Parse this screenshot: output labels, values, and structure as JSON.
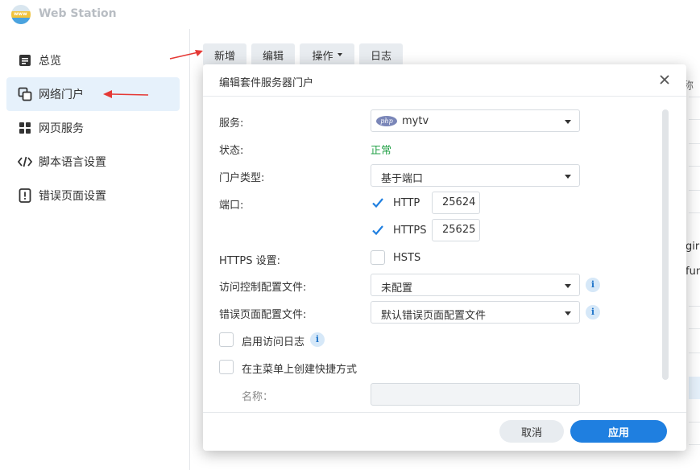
{
  "app": {
    "title": "Web Station",
    "logo_text": "www"
  },
  "sidebar": {
    "items": [
      {
        "label": "总览",
        "icon": "overview-icon"
      },
      {
        "label": "网络门户",
        "icon": "web-portal-icon"
      },
      {
        "label": "网页服务",
        "icon": "web-service-icon"
      },
      {
        "label": "脚本语言设置",
        "icon": "code-icon"
      },
      {
        "label": "错误页面设置",
        "icon": "error-page-icon"
      }
    ],
    "active_index": 1
  },
  "toolbar": {
    "add": "新增",
    "edit": "编辑",
    "action": "操作",
    "log": "日志"
  },
  "background": {
    "col_fragment": "称",
    "frag1": "gira",
    "frag2": "fun"
  },
  "dialog": {
    "title": "编辑套件服务器门户",
    "service_label": "服务:",
    "service_badge": "php",
    "service_value": "mytv",
    "status_label": "状态:",
    "status_value": "正常",
    "portal_type_label": "门户类型:",
    "portal_type_value": "基于端口",
    "port_label": "端口:",
    "http_label": "HTTP",
    "http_port": "25624",
    "http_checked": true,
    "https_label": "HTTPS",
    "https_port": "25625",
    "https_checked": true,
    "https_settings_label": "HTTPS 设置:",
    "hsts_label": "HSTS",
    "hsts_checked": false,
    "access_profile_label": "访问控制配置文件:",
    "access_profile_value": "未配置",
    "error_profile_label": "错误页面配置文件:",
    "error_profile_value": "默认错误页面配置文件",
    "enable_log_label": "启用访问日志",
    "enable_log_checked": false,
    "shortcut_label": "在主菜单上创建快捷方式",
    "shortcut_checked": false,
    "name_label": "名称：",
    "name_value": "",
    "cancel": "取消",
    "apply": "应用"
  },
  "colors": {
    "accent": "#1f7fe0",
    "status_ok": "#24a148",
    "annotation_red": "#e53935",
    "active_bg": "#e6f1fb"
  }
}
